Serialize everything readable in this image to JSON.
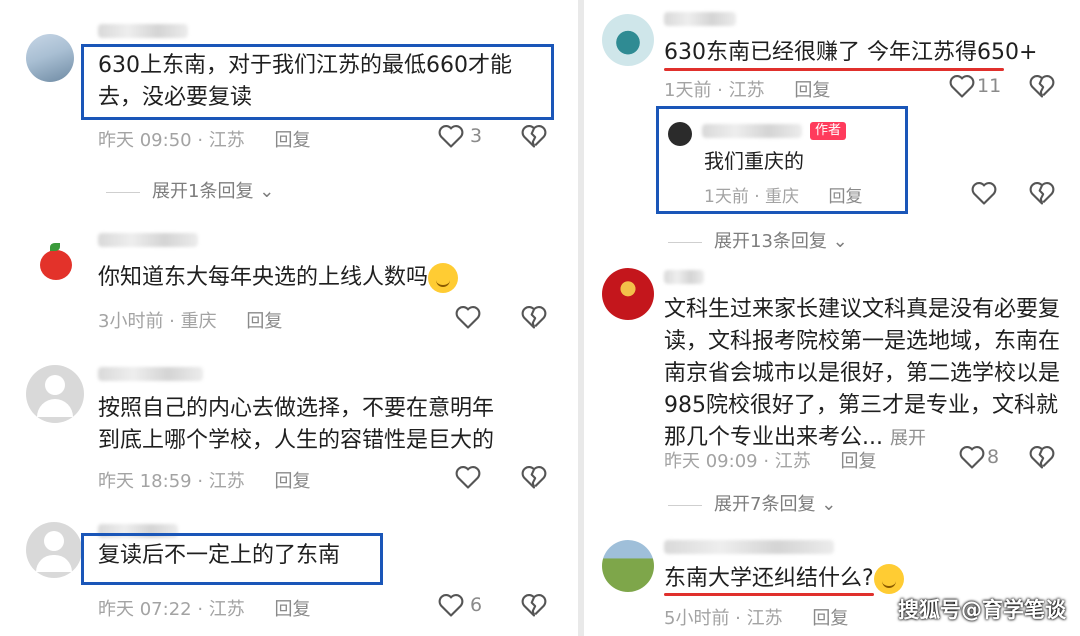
{
  "left": {
    "comments": [
      {
        "text": "630上东南，对于我们江苏的最低660才能\n去，没必要复读",
        "time": "昨天 09:50",
        "location": "江苏",
        "reply": "回复",
        "likes": "3",
        "expand": "展开1条回复"
      },
      {
        "text": "你知道东大每年央选的上线人数吗",
        "time": "3小时前",
        "location": "重庆",
        "reply": "回复"
      },
      {
        "text": "按照自己的内心去做选择，不要在意明年\n到底上哪个学校，人生的容错性是巨大的",
        "time": "昨天 18:59",
        "location": "江苏",
        "reply": "回复"
      },
      {
        "text": "复读后不一定上的了东南",
        "time": "昨天 07:22",
        "location": "江苏",
        "reply": "回复",
        "likes": "6"
      }
    ]
  },
  "right": {
    "comments": [
      {
        "text": "630东南已经很赚了 今年江苏得650+",
        "time": "1天前",
        "location": "江苏",
        "reply": "回复",
        "likes": "11"
      },
      {
        "text": "文科生过来家长建议文科真是没有必要复\n读，文科报考院校第一是选地域，东南在\n南京省会城市以是很好，第二选学校以是\n985院校很好了，第三才是专业，文科就\n那几个专业出来考公...",
        "more": "展开",
        "time": "昨天 09:09",
        "location": "江苏",
        "reply": "回复",
        "likes": "8",
        "expand": "展开7条回复"
      },
      {
        "text": "东南大学还纠结什么?",
        "time": "5小时前",
        "location": "江苏",
        "reply": "回复"
      }
    ],
    "sub_reply": {
      "author_tag": "作者",
      "text": "我们重庆的",
      "time": "1天前",
      "location": "重庆",
      "reply": "回复"
    },
    "expand_13": "展开13条回复"
  },
  "separator": " · ",
  "watermark": "搜狐号@育学笔谈",
  "colors": {
    "highlight_box": "#1a56b8",
    "underline": "#e0302c",
    "author_tag": "#ff3b5c"
  }
}
